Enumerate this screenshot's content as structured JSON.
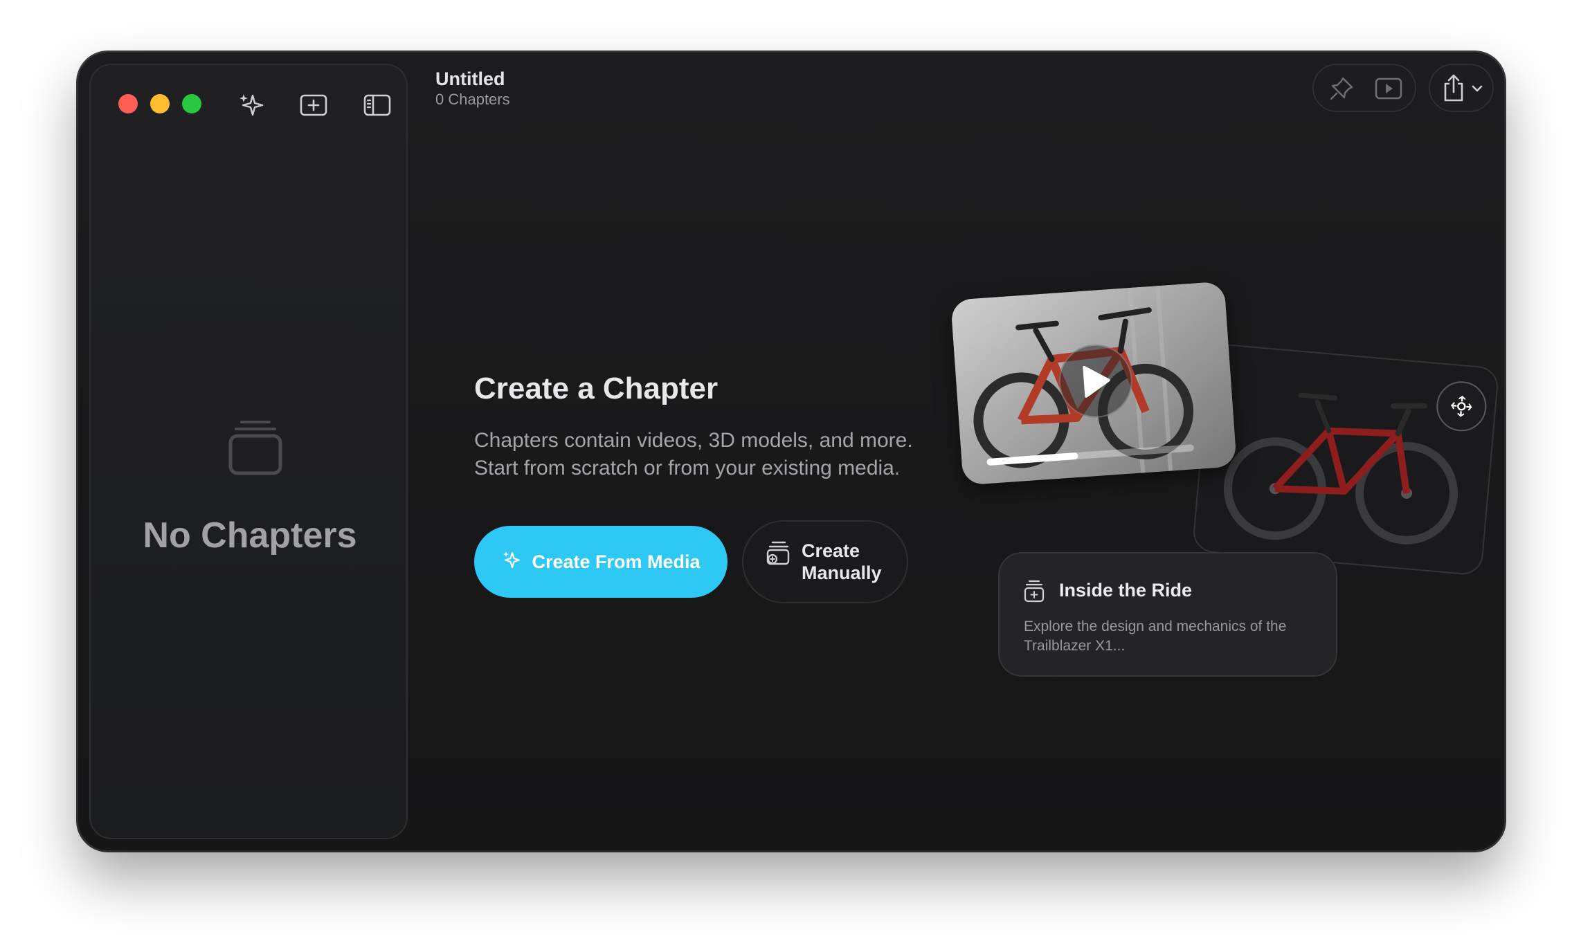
{
  "document": {
    "title": "Untitled",
    "subtitle": "0 Chapters"
  },
  "sidebar": {
    "empty_label": "No Chapters"
  },
  "main": {
    "heading": "Create a Chapter",
    "description_line1": "Chapters contain videos, 3D models, and more.",
    "description_line2": "Start from scratch or from your existing media.",
    "create_from_media_label": "Create From Media",
    "create_manually_line1": "Create",
    "create_manually_line2": "Manually"
  },
  "preview": {
    "card_title": "Inside the Ride",
    "card_description": "Explore the design and mechanics of the Trailblazer X1..."
  },
  "colors": {
    "accent": "#2ec8f5",
    "close": "#ff5f57",
    "minimize": "#febc2e",
    "maximize": "#28c840"
  }
}
